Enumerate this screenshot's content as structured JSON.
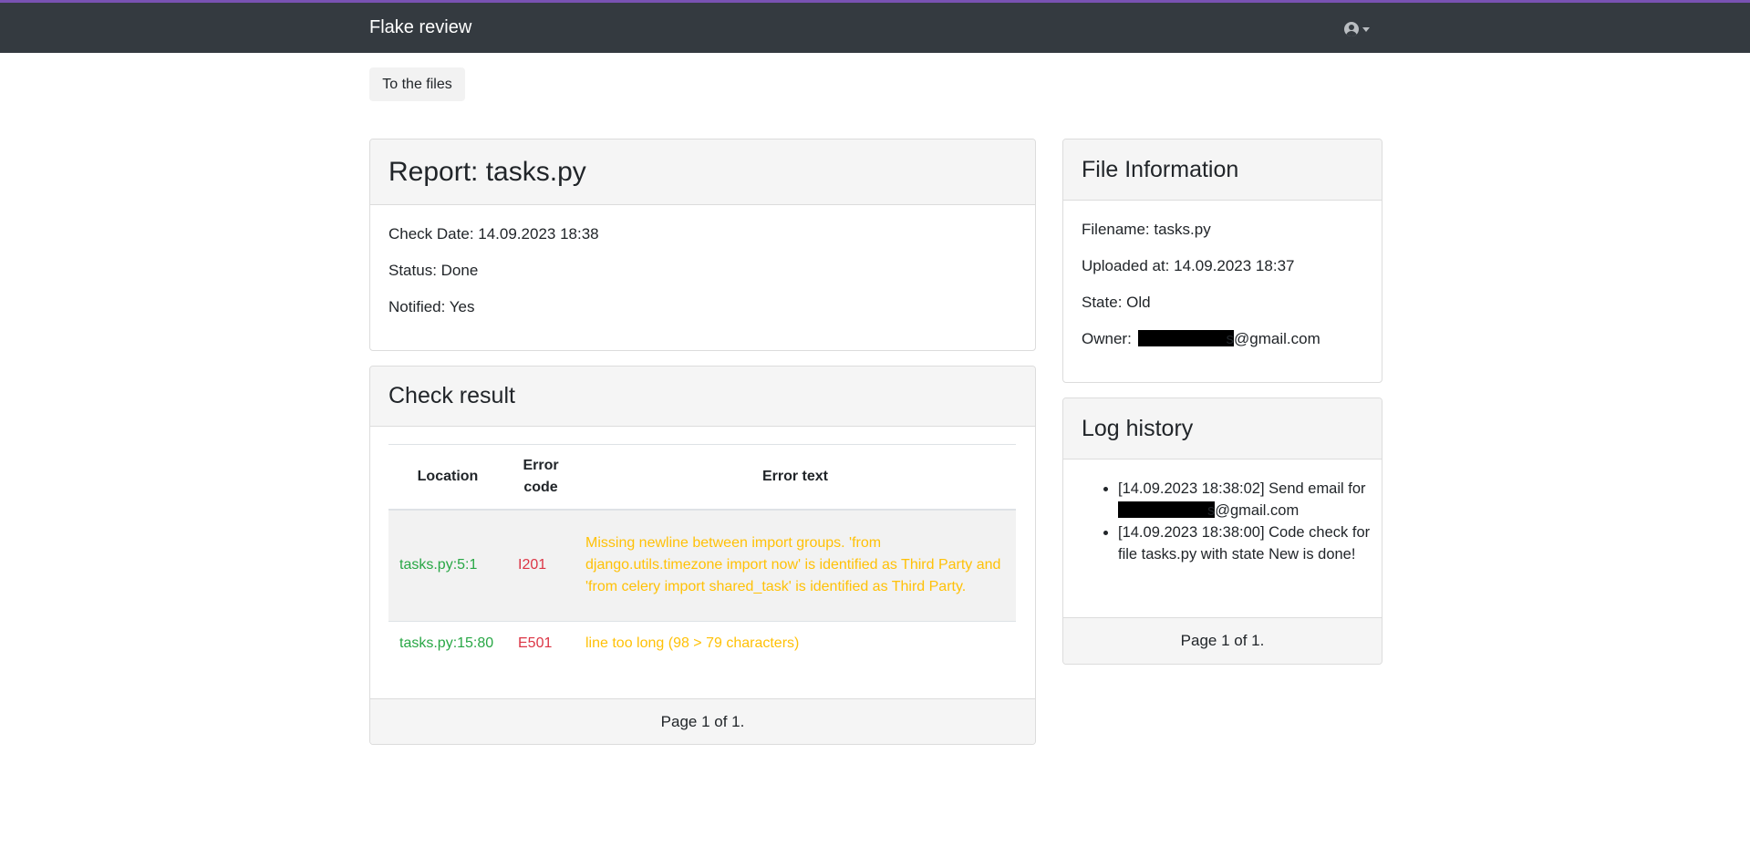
{
  "navbar": {
    "brand": "Flake review",
    "user_menu_icon": "user-circle-icon"
  },
  "back_button": "To the files",
  "report": {
    "title": "Report: tasks.py",
    "check_date": "Check Date: 14.09.2023 18:38",
    "status": "Status: Done",
    "notified": "Notified: Yes"
  },
  "check_result": {
    "title": "Check result",
    "columns": [
      "Location",
      "Error code",
      "Error text"
    ],
    "rows": [
      {
        "location": "tasks.py:5:1",
        "code": "I201",
        "text": "Missing newline between import groups. 'from django.utils.timezone import now' is identified as Third Party and 'from celery import shared_task' is identified as Third Party."
      },
      {
        "location": "tasks.py:15:80",
        "code": "E501",
        "text": "line too long (98 > 79 characters)"
      }
    ],
    "pagination": "Page 1 of 1."
  },
  "file_info": {
    "title": "File Information",
    "filename": "Filename: tasks.py",
    "uploaded_at": "Uploaded at: 14.09.2023 18:37",
    "state": "State: Old",
    "owner_label": "Owner:",
    "owner_suffix": "s@gmail.com"
  },
  "log_history": {
    "title": "Log history",
    "entries": [
      {
        "prefix": "[14.09.2023 18:38:02] Send email for",
        "suffix": "s@gmail.com"
      },
      {
        "prefix": "[14.09.2023 18:38:00] Code check for file tasks.py with state New is done!",
        "suffix": ""
      }
    ],
    "pagination": "Page 1 of 1."
  },
  "colors": {
    "navbar": "#343a40",
    "location": "#28a745",
    "error_code": "#dc3545",
    "error_text": "#ffc107"
  }
}
